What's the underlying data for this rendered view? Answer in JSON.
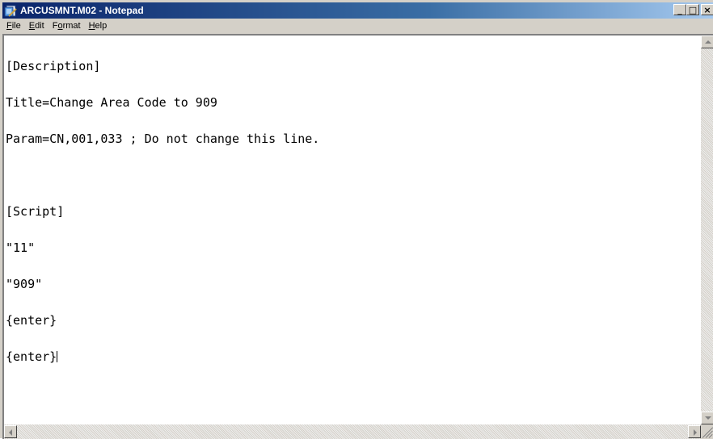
{
  "window": {
    "title": "ARCUSMNT.M02 - Notepad",
    "caption_minimize": "_",
    "caption_maximize": "□",
    "caption_close": "×",
    "colors": {
      "titlebar_start": "#0a246a",
      "titlebar_end": "#a6caf0",
      "chrome": "#d4d0c8"
    }
  },
  "menu": {
    "items": [
      {
        "label_u": "F",
        "label_rest": "ile"
      },
      {
        "label_u": "E",
        "label_rest": "dit"
      },
      {
        "label_pre": "F",
        "label_u": "o",
        "label_rest": "rmat"
      },
      {
        "label_u": "H",
        "label_rest": "elp"
      }
    ]
  },
  "editor": {
    "lines": [
      "[Description]",
      "Title=Change Area Code to 909",
      "Param=CN,001,033 ; Do not change this line.",
      "",
      "[Script]",
      "\"11\"",
      "\"909\"",
      "{enter}",
      "{enter}"
    ]
  },
  "icons": {
    "app": "notepad-icon",
    "scroll_up": "arrow-up-icon",
    "scroll_down": "arrow-down-icon",
    "scroll_left": "arrow-left-icon",
    "scroll_right": "arrow-right-icon",
    "size_grip": "size-grip-icon"
  }
}
